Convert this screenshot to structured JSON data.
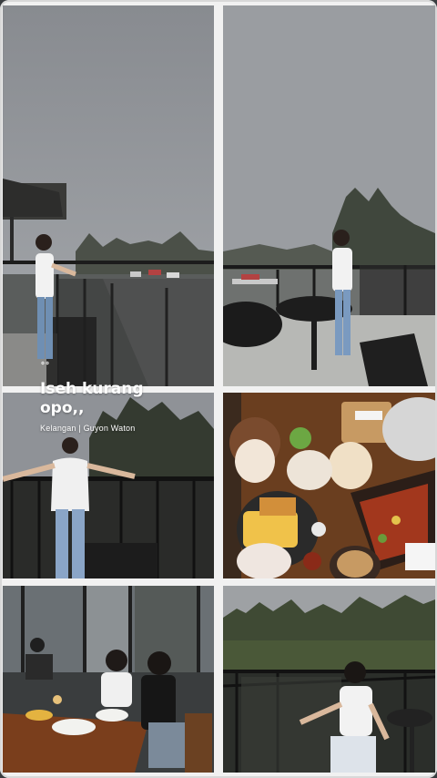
{
  "story": {
    "title": "Iseh kurang opo,,",
    "subtitle": "Kelangan | Guyon Waton",
    "decor": "°°"
  },
  "photos": [
    {
      "id": "photo-1",
      "subject": "woman-on-balcony-foggy-parking"
    },
    {
      "id": "photo-2",
      "subject": "woman-on-terrace-by-table"
    },
    {
      "id": "photo-3",
      "subject": "woman-arms-out-on-railing"
    },
    {
      "id": "photo-4",
      "subject": "food-table-overhead"
    },
    {
      "id": "photo-5",
      "subject": "two-women-at-wooden-table"
    },
    {
      "id": "photo-6",
      "subject": "woman-sitting-by-forest-railing"
    }
  ],
  "colors": {
    "sky": "#8e9196",
    "fog": "#a3a6aa",
    "frame": "#f1f1f1",
    "text": "#ffffff"
  }
}
